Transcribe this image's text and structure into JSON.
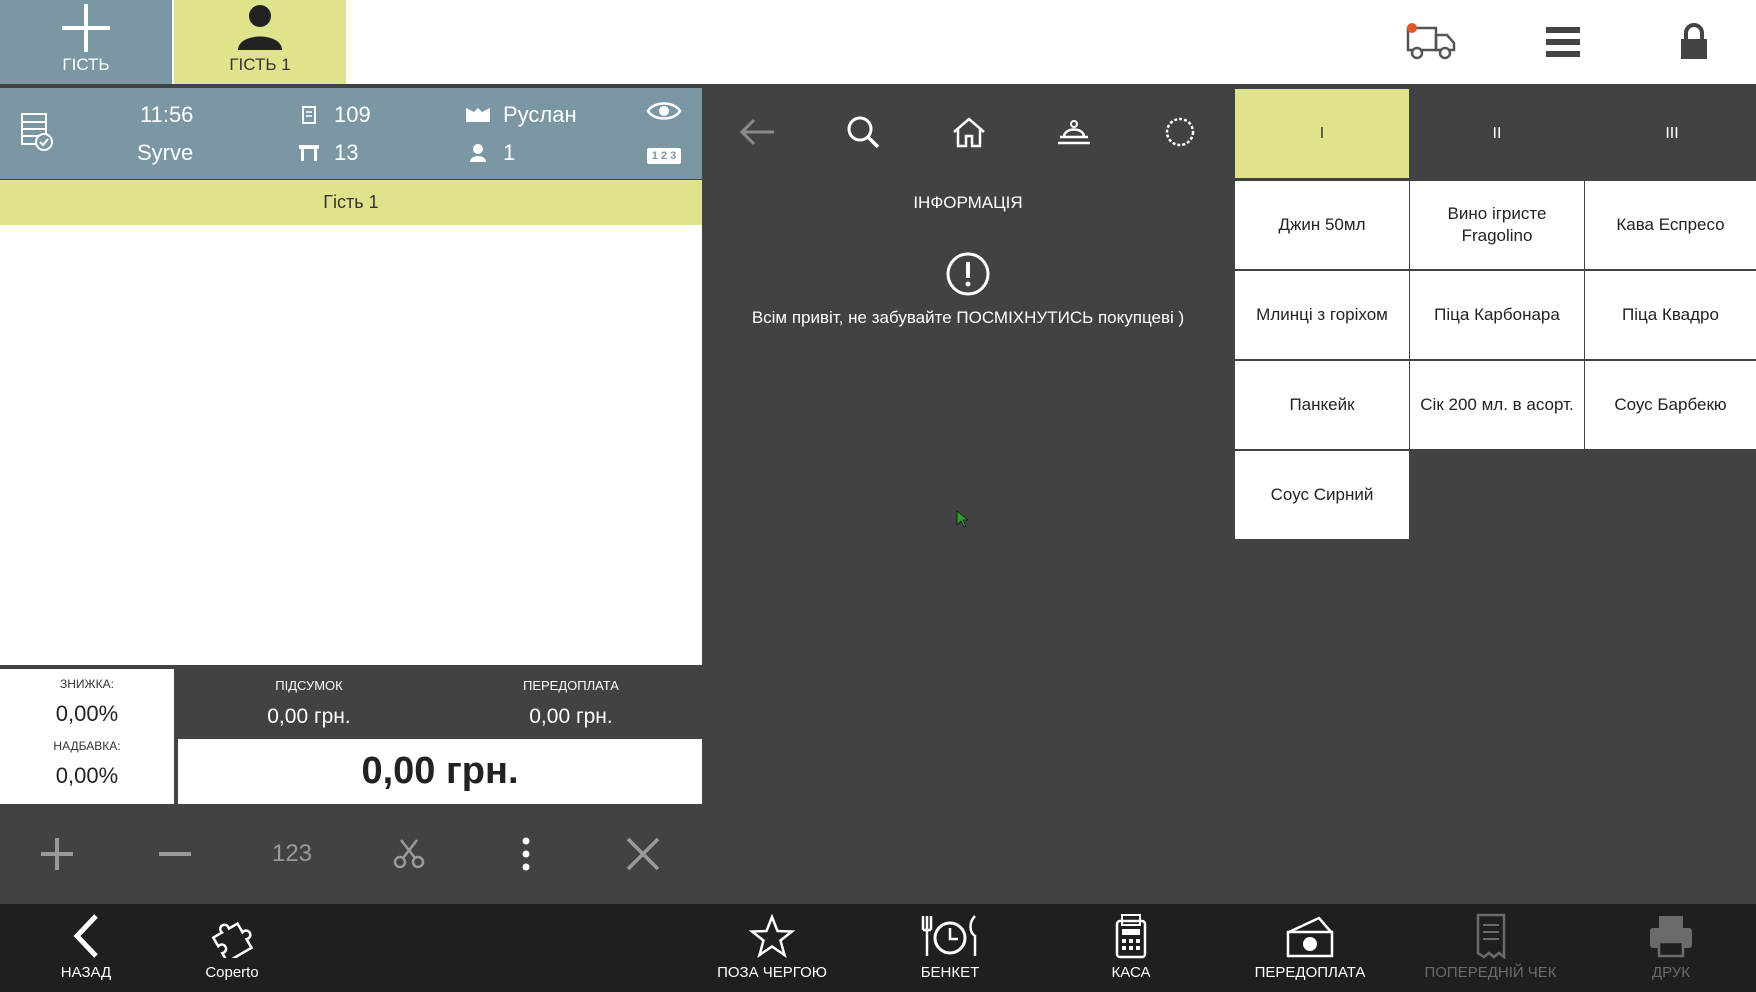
{
  "topbar": {
    "add_guest_label": "ГІСТЬ",
    "guest1_label": "ГІСТЬ 1",
    "icons": [
      "delivery-truck-icon",
      "menu-icon",
      "lock-icon"
    ],
    "notification_dot_color": "#e0572c"
  },
  "order_header": {
    "time": "11:56",
    "restaurant": "Syrve",
    "order_number": "109",
    "table_number": "13",
    "waiter": "Руслан",
    "guests_count": "1",
    "badge": "1 2 3"
  },
  "guest_strip": {
    "label": "Гість 1"
  },
  "summary": {
    "discount_label": "ЗНИЖКА:",
    "discount_value": "0,00%",
    "surcharge_label": "НАДБАВКА:",
    "surcharge_value": "0,00%",
    "subtotal_label": "ПІДСУМОК",
    "subtotal_value": "0,00 грн.",
    "prepay_label": "ПЕРЕДОПЛАТА",
    "prepay_value": "0,00 грн.",
    "total": "0,00 грн."
  },
  "order_tools": {
    "num_label": "123"
  },
  "info": {
    "title": "ІНФОРМАЦІЯ",
    "message": "Всім привіт, не забувайте ПОСМІХНУТИСЬ покупцеві )"
  },
  "categories": [
    {
      "label": "I",
      "active": true
    },
    {
      "label": "II",
      "active": false
    },
    {
      "label": "III",
      "active": false
    }
  ],
  "products": [
    "Джин 50мл",
    "Вино ігристе Fragolino",
    "Кава Еспресо",
    "Млинці з горіхом",
    "Піца Карбонара",
    "Піца Квадро",
    "Панкейк",
    "Сік 200 мл. в асорт.",
    "Соус Барбекю",
    "Соус Сирний"
  ],
  "bottom": {
    "back": "НАЗАД",
    "coperto": "Coperto",
    "queue": "ПОЗА ЧЕРГОЮ",
    "banquet": "БЕНКЕТ",
    "cash": "КАСА",
    "prepay": "ПЕРЕДОПЛАТА",
    "precheck": "ПОПЕРЕДНІЙ ЧЕК",
    "print": "ДРУК"
  },
  "colors": {
    "accent": "#dfe38c",
    "header_blue": "#7b97a4",
    "panel_dark": "#404243",
    "bottom_bar": "#1f1f1f"
  }
}
